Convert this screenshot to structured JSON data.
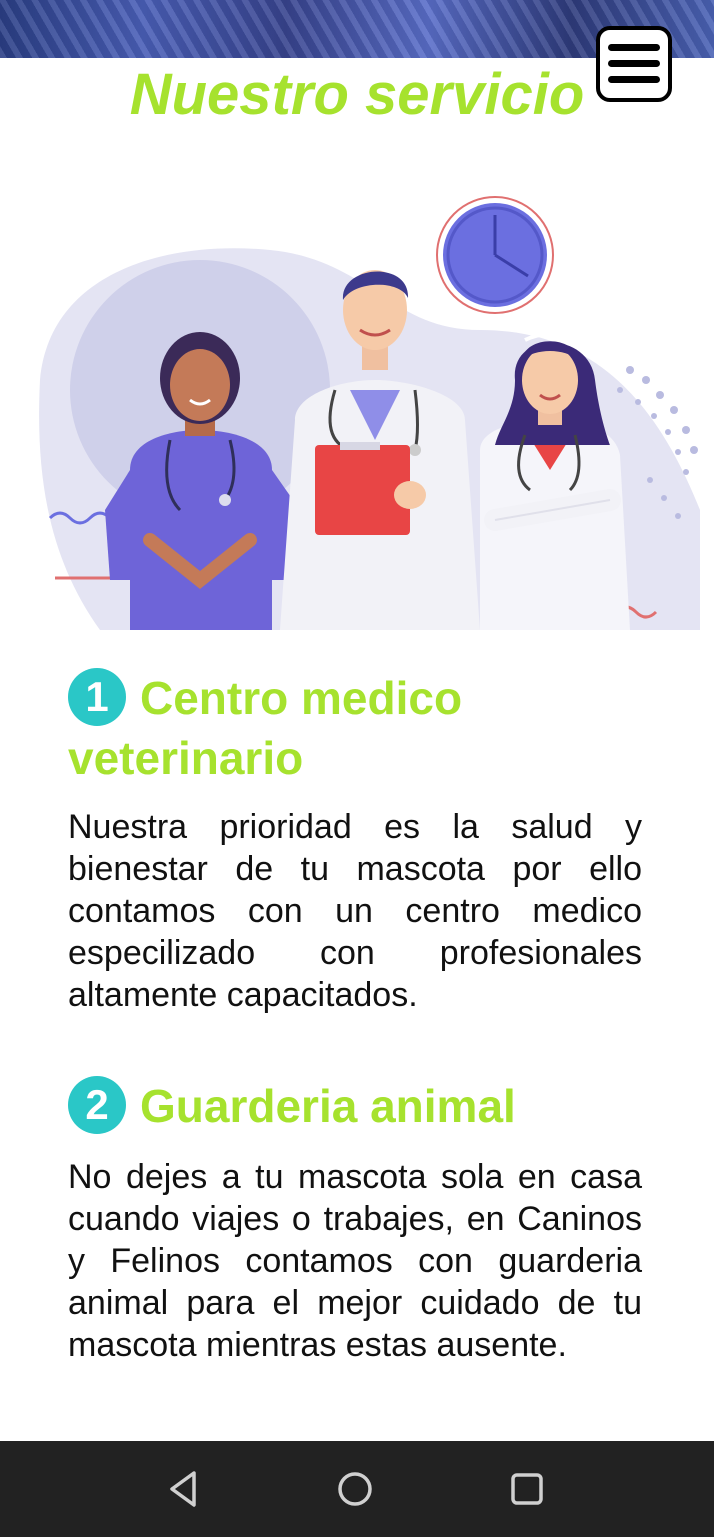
{
  "header": {
    "title": "Nuestro servicio"
  },
  "sections": [
    {
      "number": "1",
      "title": "Centro medico veterinario",
      "text": "Nuestra prioridad es la salud y bienestar de tu mascota por ello contamos con un centro medico especilizado con profesionales altamente capacitados."
    },
    {
      "number": "2",
      "title": "Guarderia animal",
      "text": "No dejes a tu mascota sola en casa cuando viajes o trabajes, en Caninos y Felinos contamos con guarderia animal para el mejor cuidado de tu mascota mientras estas ausente."
    }
  ],
  "icons": {
    "menu": "hamburger-menu-icon",
    "back": "back-triangle-icon",
    "home": "home-circle-icon",
    "recents": "recents-square-icon"
  },
  "colors": {
    "title_green": "#a6e22e",
    "number_teal": "#2ac7c7",
    "navbar": "#222222"
  }
}
